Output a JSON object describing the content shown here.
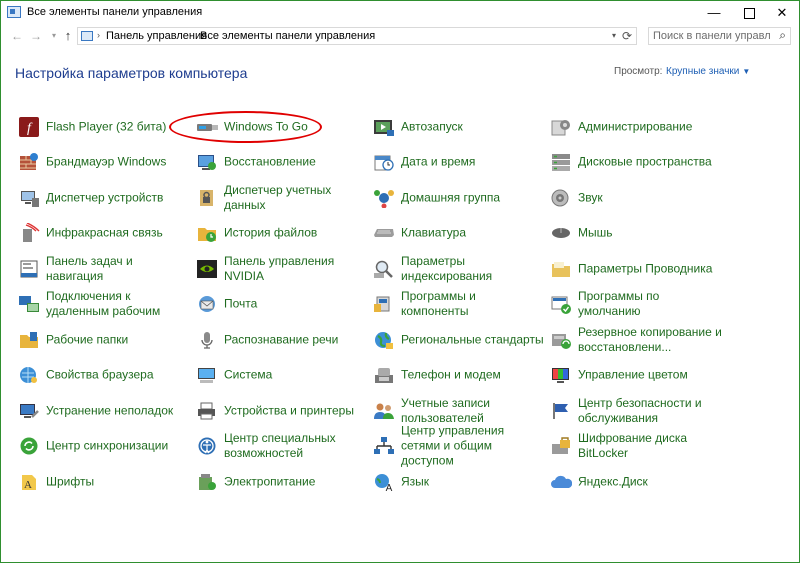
{
  "window": {
    "title": "Все элементы панели управления",
    "minimize": "—",
    "close": "✕"
  },
  "nav": {
    "back": "←",
    "forward": "→",
    "recent": "▾",
    "up": "↑"
  },
  "address": {
    "crumbs": [
      "Панель управления",
      "Все элементы панели управления"
    ],
    "separator": "›"
  },
  "search": {
    "placeholder": "Поиск в панели управления"
  },
  "header": {
    "title": "Настройка параметров компьютера",
    "view_label": "Просмотр:",
    "view_value": "Крупные значки"
  },
  "colors": {
    "link": "#1f6b1f",
    "heading": "#1e3d8f",
    "highlight": "#e00000",
    "window_border": "#2f8f2f"
  },
  "items": [
    [
      {
        "label": "Flash Player (32 бита)",
        "icon": "flash-icon"
      },
      {
        "label": "Брандмауэр Windows",
        "icon": "firewall-icon"
      },
      {
        "label": "Диспетчер устройств",
        "icon": "device-manager-icon"
      },
      {
        "label": "Инфракрасная связь",
        "icon": "infrared-icon"
      },
      {
        "label": "Панель задач и навигация",
        "icon": "taskbar-icon"
      },
      {
        "label": "Подключения к удаленным рабочим",
        "icon": "remote-connection-icon"
      },
      {
        "label": "Рабочие папки",
        "icon": "work-folders-icon"
      },
      {
        "label": "Свойства браузера",
        "icon": "browser-icon"
      },
      {
        "label": "Устранение неполадок",
        "icon": "troubleshoot-icon"
      },
      {
        "label": "Центр синхронизации",
        "icon": "sync-center-icon"
      },
      {
        "label": "Шрифты",
        "icon": "fonts-icon"
      }
    ],
    [
      {
        "label": "Windows To Go",
        "icon": "usb-drive-icon"
      },
      {
        "label": "Восстановление",
        "icon": "recovery-icon"
      },
      {
        "label": "Диспетчер учетных данных",
        "icon": "credential-manager-icon"
      },
      {
        "label": "История файлов",
        "icon": "file-history-icon"
      },
      {
        "label": "Панель управления NVIDIA",
        "icon": "nvidia-icon"
      },
      {
        "label": "Почта",
        "icon": "mail-icon"
      },
      {
        "label": "Распознавание речи",
        "icon": "microphone-icon"
      },
      {
        "label": "Система",
        "icon": "system-icon"
      },
      {
        "label": "Устройства и принтеры",
        "icon": "printer-icon"
      },
      {
        "label": "Центр специальных возможностей",
        "icon": "accessibility-icon"
      },
      {
        "label": "Электропитание",
        "icon": "power-icon"
      }
    ],
    [
      {
        "label": "Автозапуск",
        "icon": "autoplay-icon"
      },
      {
        "label": "Дата и время",
        "icon": "datetime-icon"
      },
      {
        "label": "Домашняя группа",
        "icon": "homegroup-icon"
      },
      {
        "label": "Клавиатура",
        "icon": "keyboard-icon"
      },
      {
        "label": "Параметры индексирования",
        "icon": "indexing-icon"
      },
      {
        "label": "Программы и компоненты",
        "icon": "programs-icon"
      },
      {
        "label": "Региональные стандарты",
        "icon": "region-icon"
      },
      {
        "label": "Телефон и модем",
        "icon": "phone-icon"
      },
      {
        "label": "Учетные записи пользователей",
        "icon": "users-icon"
      },
      {
        "label": "Центр управления сетями и общим доступом",
        "icon": "network-icon"
      },
      {
        "label": "Язык",
        "icon": "language-icon"
      }
    ],
    [
      {
        "label": "Администрирование",
        "icon": "admin-tools-icon"
      },
      {
        "label": "Дисковые пространства",
        "icon": "storage-spaces-icon"
      },
      {
        "label": "Звук",
        "icon": "sound-icon"
      },
      {
        "label": "Мышь",
        "icon": "mouse-icon"
      },
      {
        "label": "Параметры Проводника",
        "icon": "explorer-options-icon"
      },
      {
        "label": "Программы по умолчанию",
        "icon": "default-programs-icon"
      },
      {
        "label": "Резервное копирование и восстановлени...",
        "icon": "backup-icon"
      },
      {
        "label": "Управление цветом",
        "icon": "color-management-icon"
      },
      {
        "label": "Центр безопасности и обслуживания",
        "icon": "security-center-icon"
      },
      {
        "label": "Шифрование диска BitLocker",
        "icon": "bitlocker-icon"
      },
      {
        "label": "Яндекс.Диск",
        "icon": "yandex-disk-icon"
      }
    ]
  ]
}
